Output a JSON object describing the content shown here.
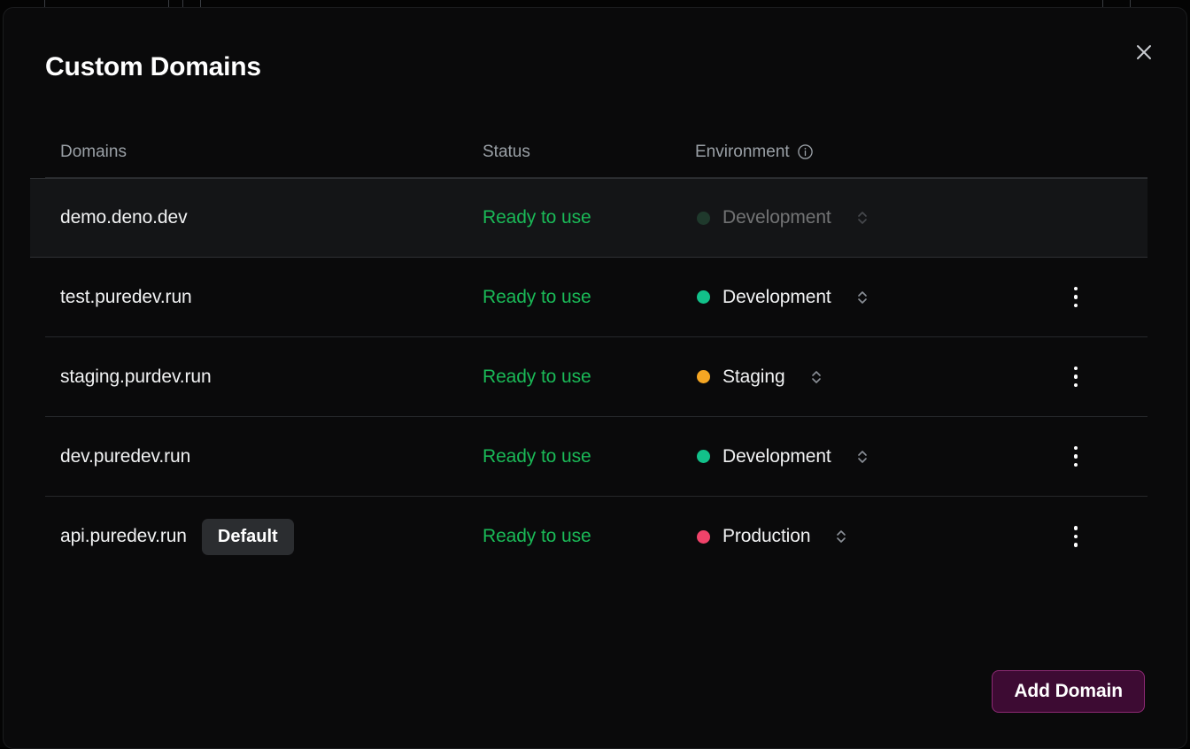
{
  "modal": {
    "title": "Custom Domains",
    "close_icon": "close-icon"
  },
  "table": {
    "headers": {
      "domains": "Domains",
      "status": "Status",
      "environment": "Environment"
    },
    "environment_info_icon": "info-circle-icon",
    "rows": [
      {
        "domain": "demo.deno.dev",
        "badge": "",
        "status": "Ready to use",
        "environment": "Development",
        "env_color": "#2f6b4b",
        "dimmed": true,
        "highlighted": true,
        "has_menu": false
      },
      {
        "domain": "test.puredev.run",
        "badge": "",
        "status": "Ready to use",
        "environment": "Development",
        "env_color": "#12c18a",
        "dimmed": false,
        "highlighted": false,
        "has_menu": true
      },
      {
        "domain": "staging.purdev.run",
        "badge": "",
        "status": "Ready to use",
        "environment": "Staging",
        "env_color": "#f5a623",
        "dimmed": false,
        "highlighted": false,
        "has_menu": true
      },
      {
        "domain": "dev.puredev.run",
        "badge": "",
        "status": "Ready to use",
        "environment": "Development",
        "env_color": "#12c18a",
        "dimmed": false,
        "highlighted": false,
        "has_menu": true
      },
      {
        "domain": "api.puredev.run",
        "badge": "Default",
        "status": "Ready to use",
        "environment": "Production",
        "env_color": "#f0436a",
        "dimmed": false,
        "highlighted": false,
        "has_menu": true
      }
    ]
  },
  "footer": {
    "add_domain_label": "Add Domain"
  },
  "colors": {
    "accent_purple_bg": "#3d0b33",
    "accent_purple_border": "#8e2a75",
    "status_green": "#1ab957",
    "modal_bg": "#0a0a0b",
    "row_highlight": "#141517"
  },
  "backdrop": {
    "column_line_positions": [
      50,
      190,
      206,
      226,
      1245,
      1276
    ]
  }
}
